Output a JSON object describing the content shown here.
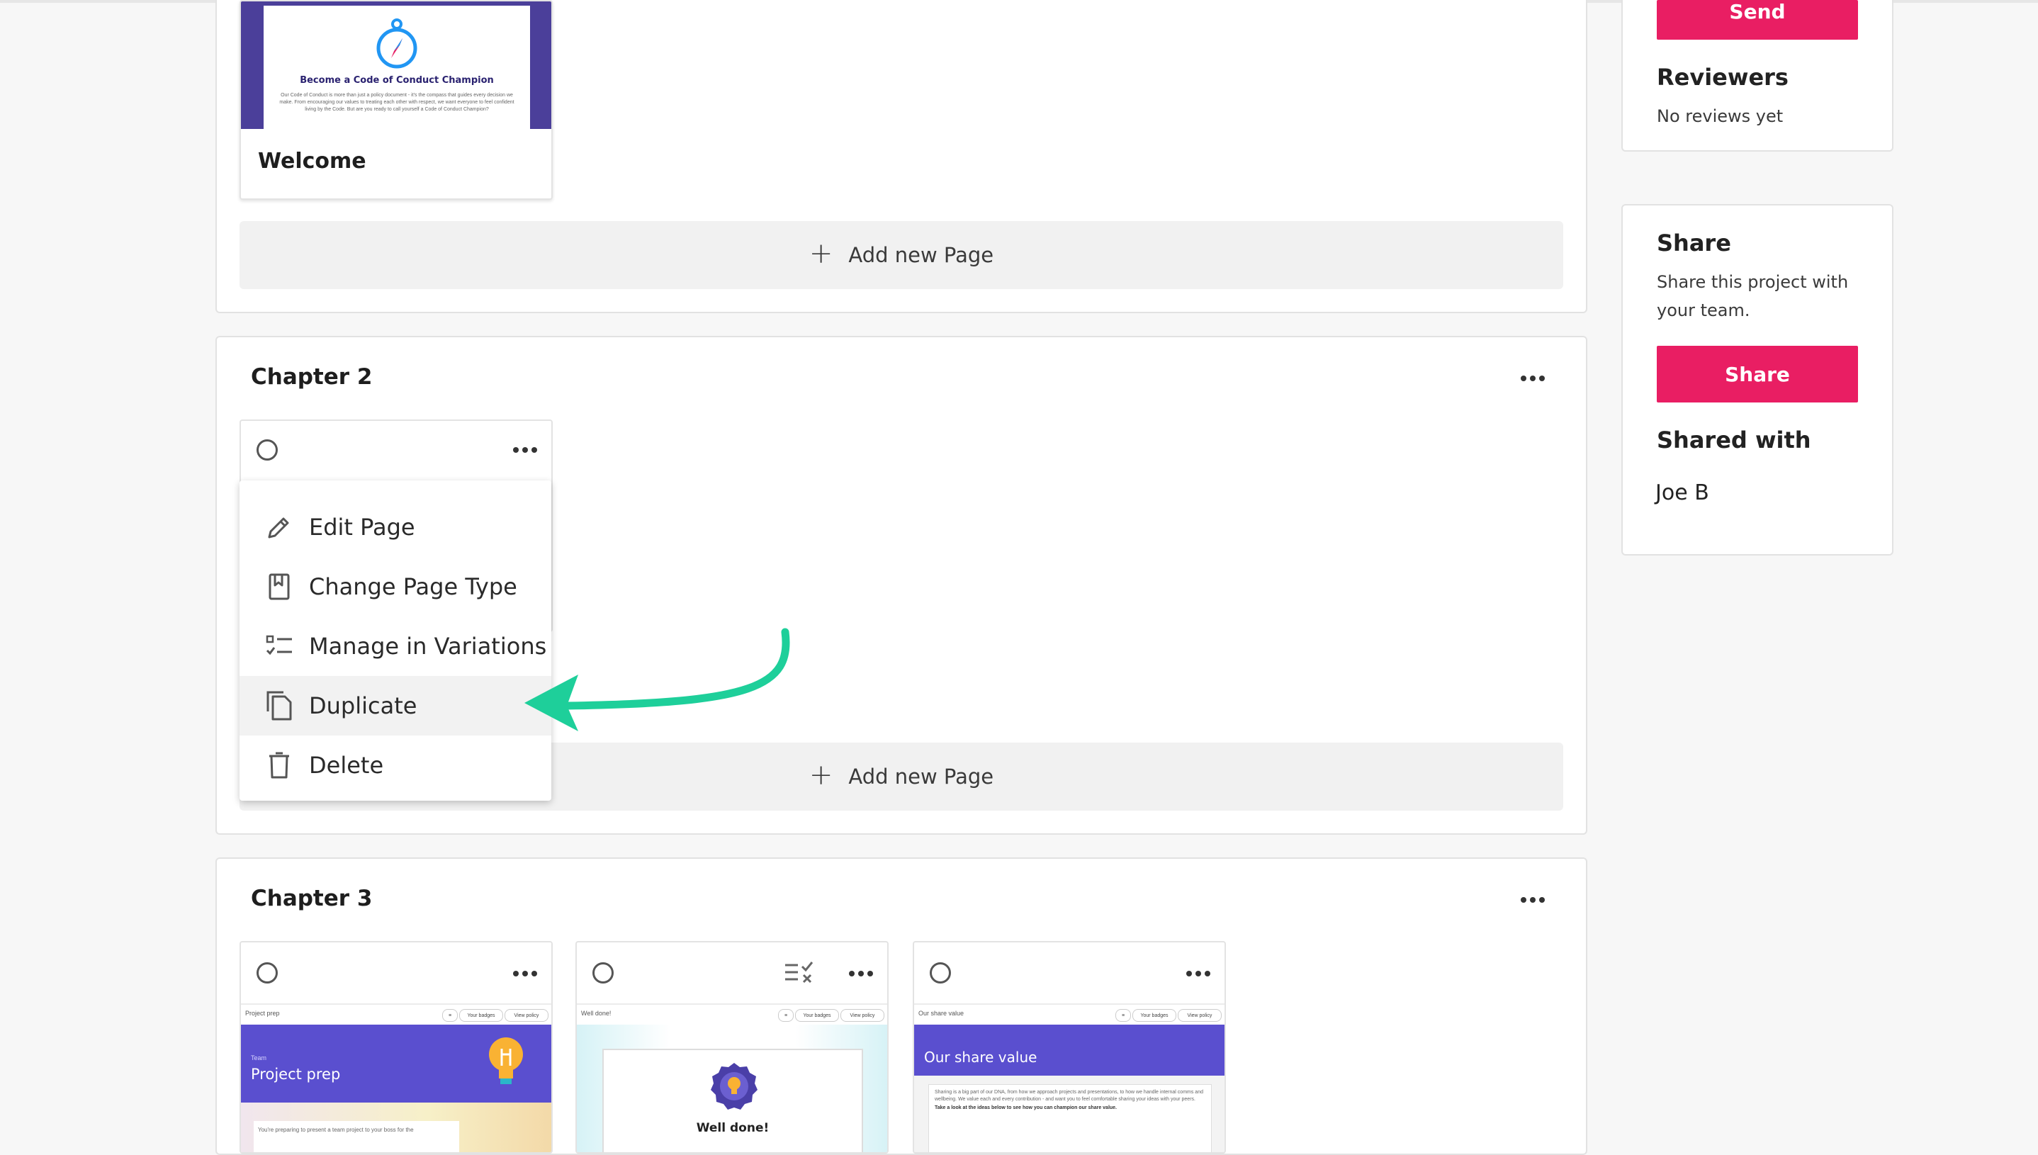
{
  "chapter1": {
    "welcome_card": {
      "thumb_title": "Become a Code of Conduct Champion",
      "thumb_body": "Our Code of Conduct is more than just a policy document - it's the compass that guides every decision we make. From encouraging our values to treating each other with respect, we want everyone to feel confident living by the Code. But are you ready to call yourself a Code of Conduct Champion?",
      "title": "Welcome"
    },
    "add_page_label": "Add new Page"
  },
  "chapter2": {
    "title": "Chapter 2",
    "add_page_label": "Add new Page",
    "menu": {
      "items": [
        {
          "label": "Edit Page",
          "icon": "pencil-icon"
        },
        {
          "label": "Change Page Type",
          "icon": "bookmark-page-icon"
        },
        {
          "label": "Manage in Variations",
          "icon": "checklist-icon"
        },
        {
          "label": "Duplicate",
          "icon": "copy-icon"
        },
        {
          "label": "Delete",
          "icon": "trash-icon"
        }
      ],
      "highlighted": "Duplicate"
    },
    "annotation_arrow_color": "#1ecf9a"
  },
  "chapter3": {
    "title": "Chapter 3",
    "cards": [
      {
        "bar_label": "Project prep",
        "btn1": "Your badges",
        "btn2": "View policy",
        "banner_small": "Team",
        "banner_title": "Project prep",
        "body": "You're preparing to present a team project to your boss for the"
      },
      {
        "bar_label": "Well done!",
        "btn1": "Your badges",
        "btn2": "View policy",
        "banner_title": "Well done!"
      },
      {
        "bar_label": "Our share value",
        "btn1": "Your badges",
        "btn2": "View policy",
        "banner_title": "Our share value",
        "body": "Sharing is a big part of our DNA, from how we approach projects and presentations, to how we handle internal comms and wellbeing. We value each and every contribution - and want you to feel comfortable sharing your ideas with your peers.",
        "body_bold": "Take a look at the ideas below to see how you can champion our share value."
      }
    ]
  },
  "sidebar": {
    "send_label": "Send",
    "reviewers_title": "Reviewers",
    "reviewers_text": "No reviews yet",
    "share_title": "Share",
    "share_text_line1": "Share this project with",
    "share_text_line2": "your team.",
    "share_button": "Share",
    "shared_with_title": "Shared with",
    "shared_with_user": "Joe B"
  },
  "colors": {
    "accent": "#e91e63",
    "banner_purple": "#5a4fcf",
    "arrow": "#1ecf9a"
  }
}
